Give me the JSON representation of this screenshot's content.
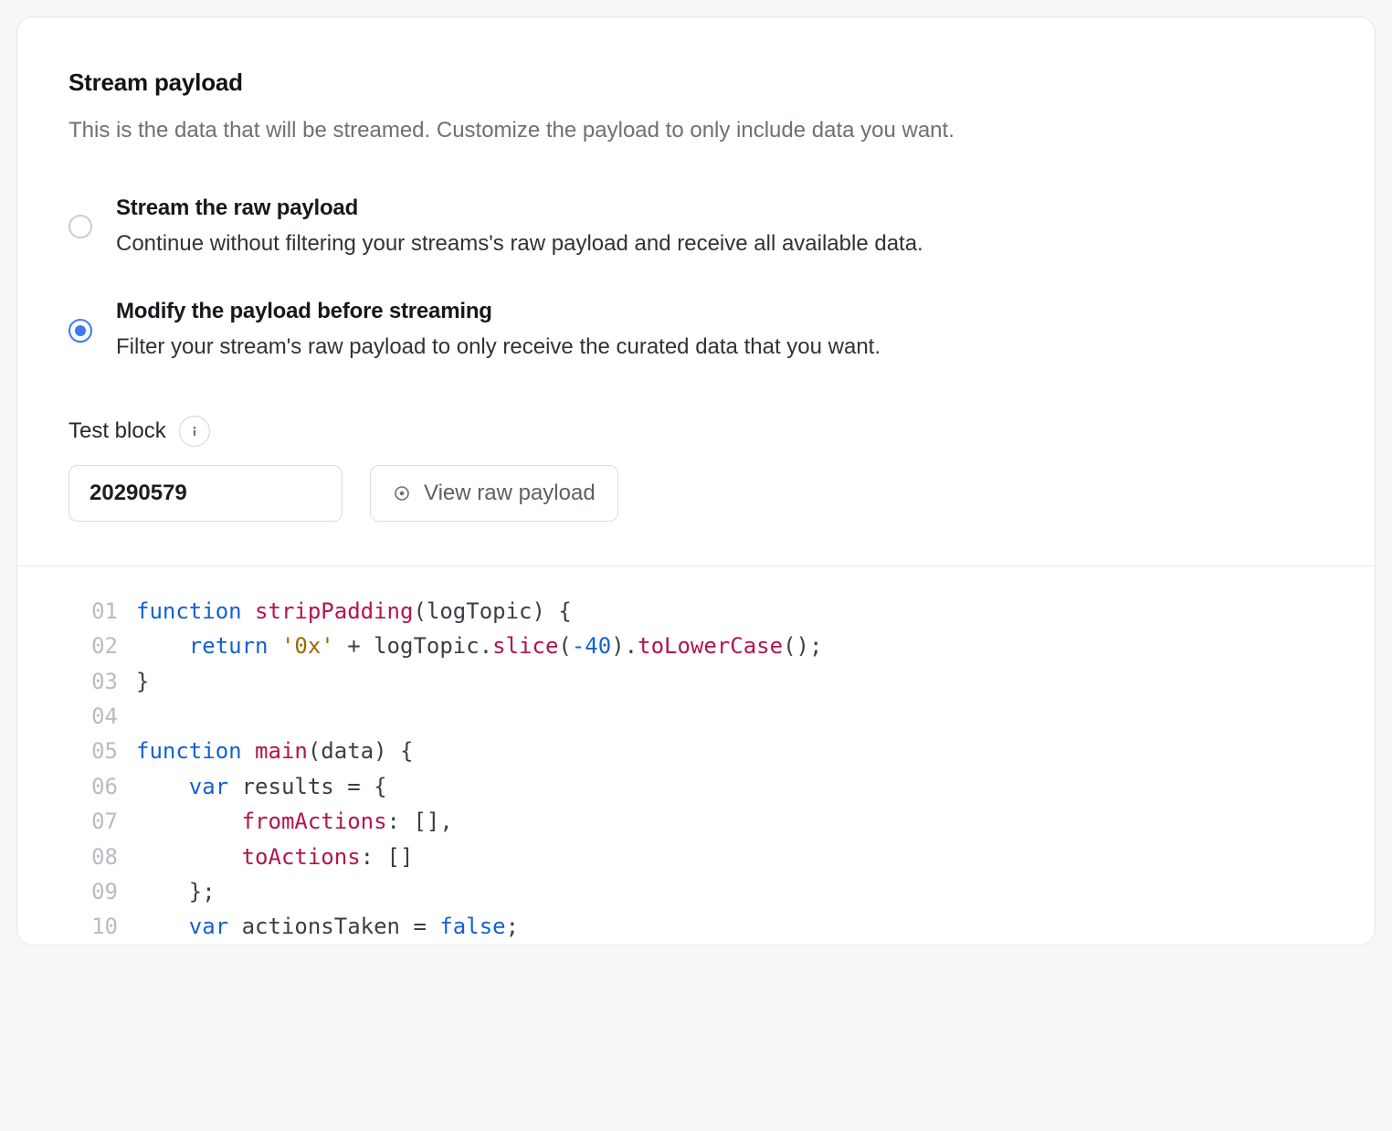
{
  "section": {
    "title": "Stream payload",
    "subtitle": "This is the data that will be streamed. Customize the payload to only include data you want."
  },
  "options": [
    {
      "id": "raw",
      "selected": false,
      "title": "Stream the raw payload",
      "desc": "Continue without filtering your streams's raw payload and receive all available data."
    },
    {
      "id": "modify",
      "selected": true,
      "title": "Modify the payload before streaming",
      "desc": "Filter your stream's raw payload to only receive the curated data that you want."
    }
  ],
  "testBlock": {
    "label": "Test block",
    "value": "20290579",
    "viewButton": "View raw payload"
  },
  "code": {
    "lines": [
      {
        "n": "01",
        "tokens": [
          {
            "t": "function",
            "c": "kw"
          },
          {
            "t": " ",
            "c": "pun"
          },
          {
            "t": "stripPadding",
            "c": "fn"
          },
          {
            "t": "(",
            "c": "pun"
          },
          {
            "t": "logTopic",
            "c": "id"
          },
          {
            "t": ") {",
            "c": "pun"
          }
        ]
      },
      {
        "n": "02",
        "tokens": [
          {
            "t": "    ",
            "c": "pun"
          },
          {
            "t": "return",
            "c": "kw"
          },
          {
            "t": " ",
            "c": "pun"
          },
          {
            "t": "'0x'",
            "c": "str"
          },
          {
            "t": " + ",
            "c": "pun"
          },
          {
            "t": "logTopic",
            "c": "id"
          },
          {
            "t": ".",
            "c": "pun"
          },
          {
            "t": "slice",
            "c": "fn"
          },
          {
            "t": "(",
            "c": "pun"
          },
          {
            "t": "-40",
            "c": "num"
          },
          {
            "t": ")",
            "c": "pun"
          },
          {
            "t": ".",
            "c": "pun"
          },
          {
            "t": "toLowerCase",
            "c": "fn"
          },
          {
            "t": "();",
            "c": "pun"
          }
        ]
      },
      {
        "n": "03",
        "tokens": [
          {
            "t": "}",
            "c": "pun"
          }
        ]
      },
      {
        "n": "04",
        "tokens": [
          {
            "t": "",
            "c": "pun"
          }
        ]
      },
      {
        "n": "05",
        "tokens": [
          {
            "t": "function",
            "c": "kw"
          },
          {
            "t": " ",
            "c": "pun"
          },
          {
            "t": "main",
            "c": "fn"
          },
          {
            "t": "(",
            "c": "pun"
          },
          {
            "t": "data",
            "c": "id"
          },
          {
            "t": ") {",
            "c": "pun"
          }
        ]
      },
      {
        "n": "06",
        "tokens": [
          {
            "t": "    ",
            "c": "pun"
          },
          {
            "t": "var",
            "c": "kw"
          },
          {
            "t": " results = {",
            "c": "pun"
          }
        ]
      },
      {
        "n": "07",
        "tokens": [
          {
            "t": "        ",
            "c": "pun"
          },
          {
            "t": "fromActions",
            "c": "fn"
          },
          {
            "t": ": [],",
            "c": "pun"
          }
        ]
      },
      {
        "n": "08",
        "tokens": [
          {
            "t": "        ",
            "c": "pun"
          },
          {
            "t": "toActions",
            "c": "fn"
          },
          {
            "t": ": []",
            "c": "pun"
          }
        ]
      },
      {
        "n": "09",
        "tokens": [
          {
            "t": "    };",
            "c": "pun"
          }
        ]
      },
      {
        "n": "10",
        "tokens": [
          {
            "t": "    ",
            "c": "pun"
          },
          {
            "t": "var",
            "c": "kw"
          },
          {
            "t": " actionsTaken = ",
            "c": "pun"
          },
          {
            "t": "false",
            "c": "bool"
          },
          {
            "t": ";",
            "c": "pun"
          }
        ]
      }
    ]
  }
}
